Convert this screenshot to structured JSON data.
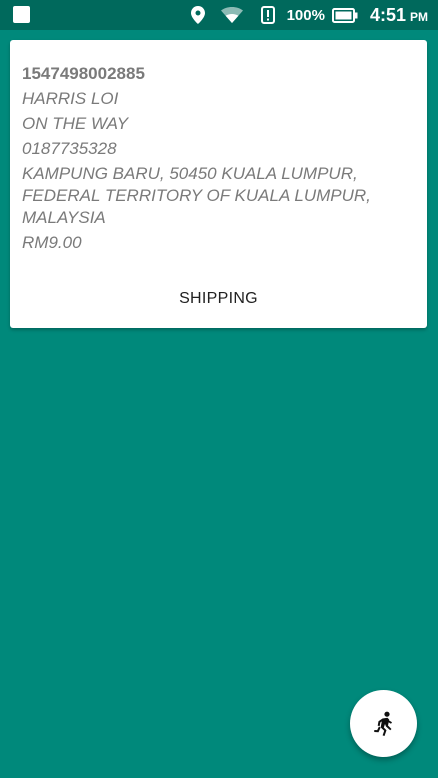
{
  "status_bar": {
    "battery_text": "100%",
    "time": "4:51",
    "ampm": "PM",
    "icons": [
      "notification-square-icon",
      "location-pin-icon",
      "wifi-icon",
      "alert-icon",
      "battery-icon"
    ]
  },
  "order": {
    "id": "1547498002885",
    "name": "HARRIS LOI",
    "status": "ON THE WAY",
    "phone": "0187735328",
    "address_lines": [
      "KAMPUNG BARU, 50450 KUALA LUMPUR,",
      "FEDERAL TERRITORY OF KUALA LUMPUR,",
      "MALAYSIA"
    ],
    "price": "RM9.00",
    "action_label": "SHIPPING"
  },
  "fab": {
    "icon": "running-person-icon"
  },
  "colors": {
    "background": "#00897B",
    "status_bar": "#00695C",
    "card": "#ffffff",
    "secondary_text": "#7a7a7a"
  }
}
